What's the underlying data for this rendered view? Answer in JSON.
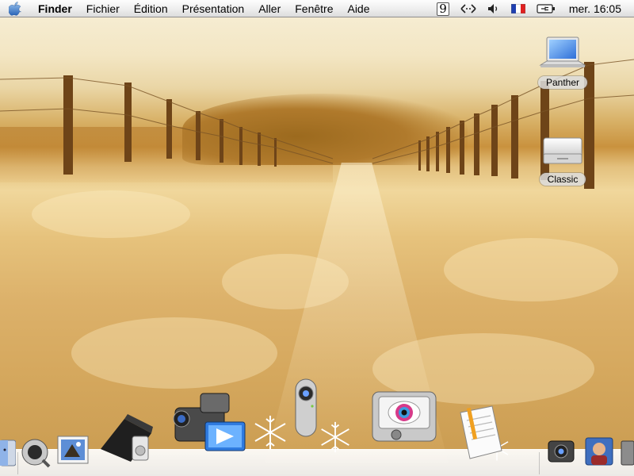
{
  "menubar": {
    "app_name": "Finder",
    "menus": [
      "Fichier",
      "Édition",
      "Présentation",
      "Aller",
      "Fenêtre",
      "Aide"
    ],
    "status_items": {
      "script_label": "9",
      "clock": "mer. 16:05"
    }
  },
  "desktop": {
    "icons": [
      {
        "label": "Panther",
        "icon": "laptop-icon"
      },
      {
        "label": "Classic",
        "icon": "mac-mini-icon"
      }
    ]
  },
  "dock": {
    "items": [
      {
        "icon": "finder-icon"
      },
      {
        "icon": "mail-icon"
      },
      {
        "icon": "garageband-icon"
      },
      {
        "icon": "iphoto-icon"
      },
      {
        "icon": "imovie-icon"
      },
      {
        "icon": "isight-camera-icon"
      },
      {
        "icon": "image-capture-icon"
      },
      {
        "icon": "textedit-icon"
      },
      {
        "icon": "photo-booth-icon"
      },
      {
        "icon": "ichat-icon"
      }
    ]
  },
  "colors": {
    "menubar_bg": "#eeeeee",
    "wallpaper_tone": "#d9b35c"
  }
}
